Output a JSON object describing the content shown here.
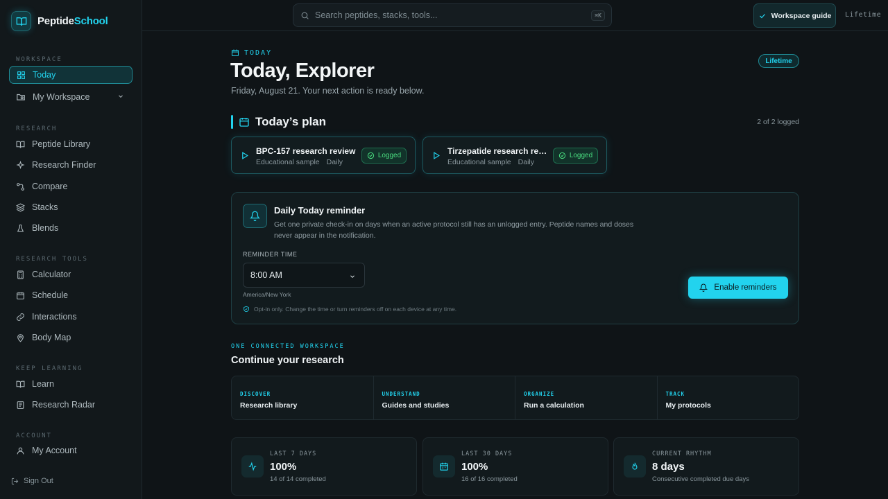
{
  "brand": {
    "name_main": "Peptide",
    "name_accent": "School"
  },
  "sidebar": {
    "sections": {
      "workspace": "WORKSPACE",
      "research": "RESEARCH",
      "research_tools": "RESEARCH TOOLS",
      "keep_learning": "KEEP LEARNING",
      "account": "ACCOUNT"
    },
    "items": {
      "today": "Today",
      "my_workspace": "My Workspace",
      "peptide_library": "Peptide Library",
      "research_finder": "Research Finder",
      "compare": "Compare",
      "stacks": "Stacks",
      "blends": "Blends",
      "calculator": "Calculator",
      "schedule": "Schedule",
      "interactions": "Interactions",
      "body_map": "Body Map",
      "learn": "Learn",
      "research_radar": "Research Radar",
      "my_account": "My Account"
    },
    "sign_out": "Sign Out"
  },
  "topbar": {
    "search_placeholder": "Search peptides, stacks, tools...",
    "shortcut": "⌘K",
    "guide_label": "Workspace guide",
    "plan_label": "Lifetime"
  },
  "header": {
    "eyebrow": "TODAY",
    "title": "Today, Explorer",
    "subtitle": "Friday, August 21. Your next action is ready below.",
    "badge": "Lifetime"
  },
  "plan": {
    "title": "Today’s plan",
    "count": "2 of 2 logged",
    "items": [
      {
        "title": "BPC-157 research review",
        "tag": "Educational sample",
        "freq": "Daily",
        "status": "Logged"
      },
      {
        "title": "Tirzepatide research review",
        "tag": "Educational sample",
        "freq": "Daily",
        "status": "Logged"
      }
    ]
  },
  "reminder": {
    "title": "Daily Today reminder",
    "description": "Get one private check-in on days when an active protocol still has an unlogged entry. Peptide names and doses never appear in the notification.",
    "time_label": "REMINDER TIME",
    "time_value": "8:00 AM",
    "timezone": "America/New York",
    "note": "Opt-in only. Change the time or turn reminders off on each device at any time.",
    "button": "Enable reminders"
  },
  "continue": {
    "eyebrow": "ONE CONNECTED WORKSPACE",
    "title": "Continue your research",
    "cells": [
      {
        "key": "DISCOVER",
        "value": "Research library"
      },
      {
        "key": "UNDERSTAND",
        "value": "Guides and studies"
      },
      {
        "key": "ORGANIZE",
        "value": "Run a calculation"
      },
      {
        "key": "TRACK",
        "value": "My protocols"
      }
    ]
  },
  "stats": [
    {
      "label": "LAST 7 DAYS",
      "value": "100%",
      "sub": "14 of 14 completed",
      "icon": "activity-icon"
    },
    {
      "label": "LAST 30 DAYS",
      "value": "100%",
      "sub": "16 of 16 completed",
      "icon": "calendar-icon"
    },
    {
      "label": "CURRENT RHYTHM",
      "value": "8 days",
      "sub": "Consecutive completed due days",
      "icon": "flame-icon"
    }
  ],
  "colors": {
    "accent": "#22d3ee",
    "success": "#4ade80",
    "background": "#0f1417"
  }
}
